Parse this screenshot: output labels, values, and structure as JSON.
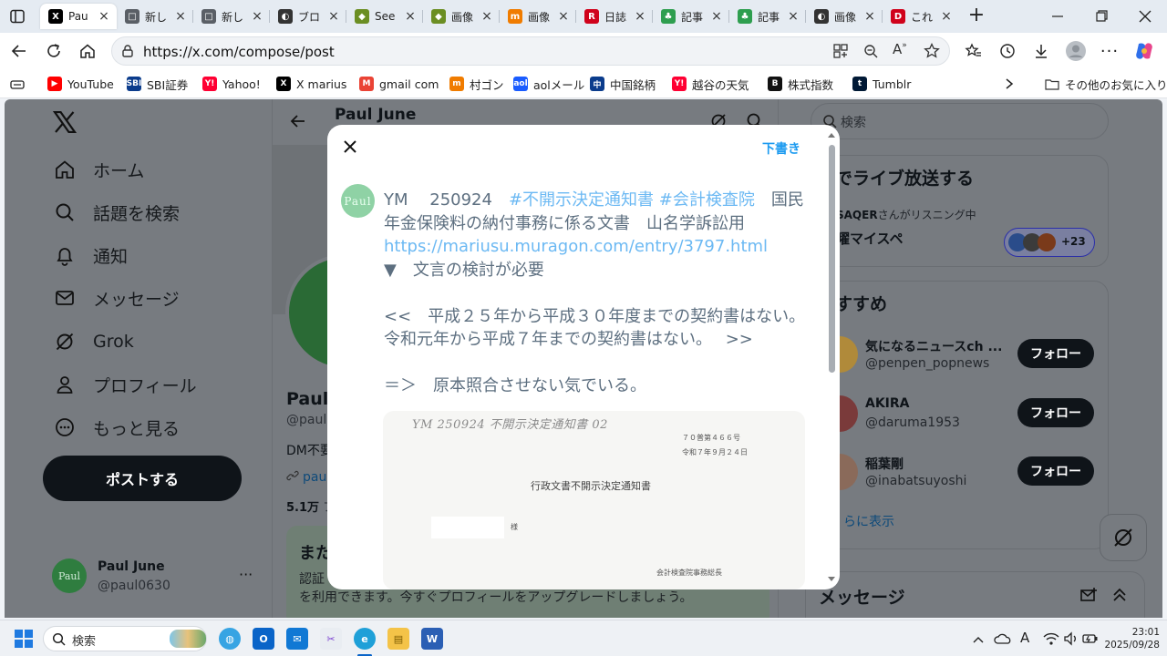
{
  "browser": {
    "tabs": [
      {
        "title": "Pau",
        "favicon": "X",
        "favcolor": "#000000",
        "active": true
      },
      {
        "title": "新し",
        "favicon": "□",
        "favcolor": "#5a5f66"
      },
      {
        "title": "新し",
        "favicon": "□",
        "favcolor": "#5a5f66"
      },
      {
        "title": "ブロ",
        "favicon": "◐",
        "favcolor": "#333333"
      },
      {
        "title": "See",
        "favicon": "◆",
        "favcolor": "#6b8e23"
      },
      {
        "title": "画像",
        "favicon": "◆",
        "favcolor": "#6b8e23"
      },
      {
        "title": "画像",
        "favicon": "m",
        "favcolor": "#f07c00"
      },
      {
        "title": "日誌",
        "favicon": "R",
        "favcolor": "#d0021b"
      },
      {
        "title": "記事",
        "favicon": "♣",
        "favcolor": "#2e9e4f"
      },
      {
        "title": "記事",
        "favicon": "♣",
        "favcolor": "#2e9e4f"
      },
      {
        "title": "画像",
        "favicon": "◐",
        "favcolor": "#333333"
      },
      {
        "title": "これ",
        "favicon": "D",
        "favcolor": "#d0021b"
      }
    ],
    "url": "https://x.com/compose/post",
    "bookmarks": [
      {
        "label": "YouTube",
        "icon": "▶",
        "color": "#ff0000"
      },
      {
        "label": "SBI証券",
        "icon": "SBI",
        "color": "#0b3c8c"
      },
      {
        "label": "Yahoo!",
        "icon": "Y!",
        "color": "#ff0033"
      },
      {
        "label": "X marius",
        "icon": "X",
        "color": "#000000"
      },
      {
        "label": "gmail com",
        "icon": "M",
        "color": "#ea4335"
      },
      {
        "label": "村ゴン",
        "icon": "m",
        "color": "#f07c00"
      },
      {
        "label": "aolメール",
        "icon": "aol",
        "color": "#1a5cff"
      },
      {
        "label": "中国銘柄",
        "icon": "中",
        "color": "#0b3c8c"
      },
      {
        "label": "越谷の天気",
        "icon": "Y!",
        "color": "#ff0033"
      },
      {
        "label": "株式指数",
        "icon": "B",
        "color": "#111111"
      },
      {
        "label": "Tumblr",
        "icon": "t",
        "color": "#001935"
      }
    ],
    "other_bookmarks": "その他のお気に入り"
  },
  "sidebar": {
    "items": [
      {
        "label": "ホーム",
        "icon": "home-icon"
      },
      {
        "label": "話題を検索",
        "icon": "search-icon"
      },
      {
        "label": "通知",
        "icon": "bell-icon"
      },
      {
        "label": "メッセージ",
        "icon": "mail-icon"
      },
      {
        "label": "Grok",
        "icon": "grok-icon"
      },
      {
        "label": "プロフィール",
        "icon": "person-icon"
      },
      {
        "label": "もっと見る",
        "icon": "more-circle-icon"
      }
    ],
    "post_button": "ポストする",
    "account": {
      "name": "Paul June",
      "handle": "@paul0630"
    }
  },
  "profile": {
    "header_name": "Paul June",
    "name": "Paul",
    "handle": "@paul0",
    "bio": "DM不要",
    "link": "pau",
    "followers": "5.1万",
    "followers_suffix": "フ",
    "premium_title": "また",
    "premium_text_1": "認証",
    "premium_text_2": "を利用できます。今すぐプロフィールをアップグレードしましょう。"
  },
  "rightcol": {
    "search_placeholder": "検索",
    "live_title": "でライブ放送する",
    "live_host": "SAQER",
    "live_listening": "さんがリスニング中",
    "live_space": "曜マイスペ",
    "live_count": "+23",
    "recommend_title": "すすめ",
    "users": [
      {
        "name": "気になるニュースch ...",
        "handle": "@penpen_popnews"
      },
      {
        "name": "AKIRA",
        "handle": "@daruma1953"
      },
      {
        "name": "稲葉剛",
        "handle": "@inabatsuyoshi"
      }
    ],
    "follow_label": "フォロー",
    "show_more": "らに表示",
    "messages_title": "メッセージ"
  },
  "modal": {
    "drafts": "下書き",
    "avatar_text": "Paul",
    "line1_a": "YM　 250924　",
    "line1_tag1": "#不開示決定通知書",
    "line1_tag2": "#会計検査院",
    "line1_b": "　国民年金保険料の納付事務に係る文書　山名学訴訟用",
    "link": "https://mariusu.muragon.com/entry/3797.html",
    "line3": "▼　文言の検討が必要",
    "quote": "<<　平成２５年から平成３０年度までの契約書はない。令和元年から平成７年までの契約書はない。　 >>",
    "conclusion": "＝＞　原本照合させない気でいる。"
  },
  "document": {
    "handwritten": "YM 250924 不開示決定通知書 02",
    "number": "７０普第４６６号",
    "date": "令和７年９月２４日",
    "title": "行政文書不開示決定通知書",
    "recipient_suffix": "様",
    "sender": "会計検査院事務総長"
  },
  "taskbar": {
    "search_placeholder": "検索",
    "time": "23:01",
    "date": "2025/09/28"
  },
  "colors": {
    "accent": "#1d9bf0",
    "overlay": "#777b80"
  }
}
